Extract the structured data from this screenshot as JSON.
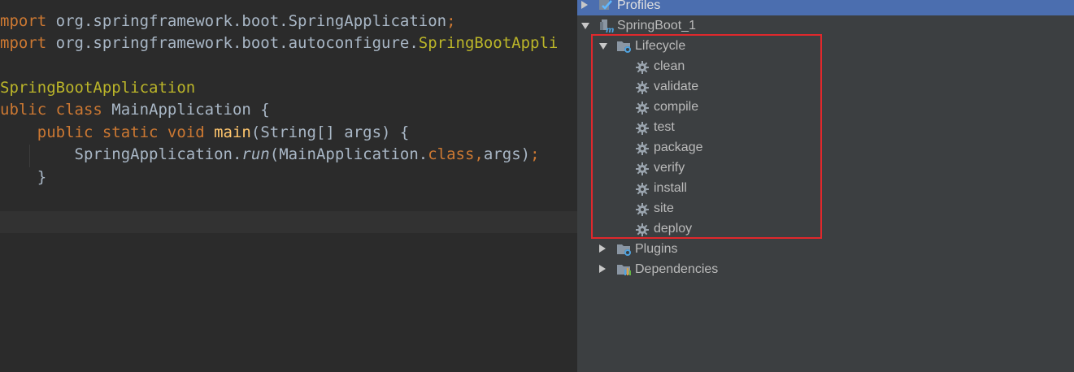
{
  "editor": {
    "lines": [
      {
        "parts": [
          {
            "t": "mport ",
            "c": "kw"
          },
          {
            "t": "org.springframework.boot.SpringApplication",
            "c": ""
          },
          {
            "t": ";",
            "c": "kw"
          }
        ]
      },
      {
        "parts": [
          {
            "t": "mport ",
            "c": "kw"
          },
          {
            "t": "org.springframework.boot.autoconfigure.",
            "c": ""
          },
          {
            "t": "SpringBootAppli",
            "c": "ann"
          }
        ]
      },
      {
        "parts": [
          {
            "t": "",
            "c": ""
          }
        ]
      },
      {
        "parts": [
          {
            "t": "SpringBootApplication",
            "c": "ann"
          }
        ]
      },
      {
        "parts": [
          {
            "t": "ublic class ",
            "c": "kw"
          },
          {
            "t": "MainApplication {",
            "c": ""
          }
        ]
      },
      {
        "parts": [
          {
            "t": "    public static void ",
            "c": "kw"
          },
          {
            "t": "main",
            "c": "fn"
          },
          {
            "t": "(String[] args) {",
            "c": ""
          }
        ]
      },
      {
        "parts": [
          {
            "t": "        SpringApplication.",
            "c": ""
          },
          {
            "t": "run",
            "c": "ital"
          },
          {
            "t": "(MainApplication.",
            "c": ""
          },
          {
            "t": "class",
            "c": "kw"
          },
          {
            "t": ",",
            "c": "kw"
          },
          {
            "t": "args)",
            "c": ""
          },
          {
            "t": ";",
            "c": "kw"
          }
        ]
      },
      {
        "parts": [
          {
            "t": "    }",
            "c": ""
          }
        ]
      }
    ]
  },
  "maven": {
    "profiles_label": "Profiles",
    "project_label": "SpringBoot_1",
    "lifecycle_label": "Lifecycle",
    "lifecycle_phases": [
      "clean",
      "validate",
      "compile",
      "test",
      "package",
      "verify",
      "install",
      "site",
      "deploy"
    ],
    "plugins_label": "Plugins",
    "dependencies_label": "Dependencies"
  },
  "colors": {
    "highlight_border": "#e0282c",
    "selected_row": "#4b6eaf",
    "panel_bg": "#3c3f41",
    "editor_bg": "#2b2b2b"
  },
  "icons": {
    "profiles": "profiles-check-icon",
    "project": "maven-module-icon",
    "lifecycle": "folder-gear-icon",
    "phase": "gear-icon",
    "plugins": "folder-gear-icon",
    "dependencies": "folder-bars-icon"
  }
}
